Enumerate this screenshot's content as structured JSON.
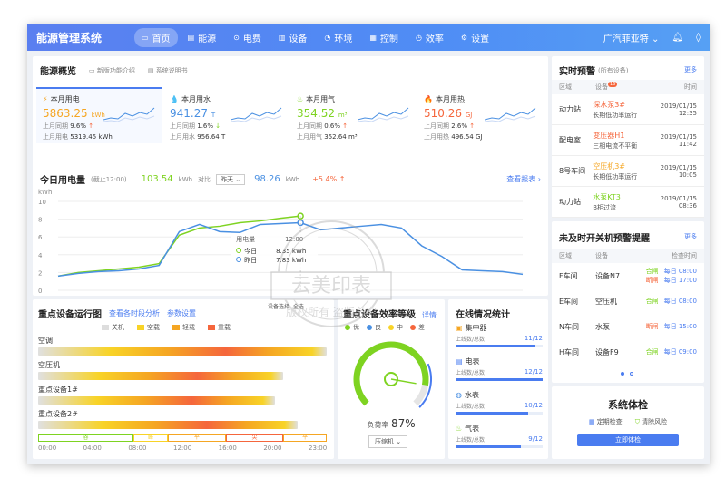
{
  "app": {
    "title": "能源管理系统",
    "user": "广汽菲亚特",
    "user_caret": "⌄"
  },
  "nav": [
    {
      "icon": "▭",
      "label": "首页",
      "active": true
    },
    {
      "icon": "▤",
      "label": "能源"
    },
    {
      "icon": "⊙",
      "label": "电费"
    },
    {
      "icon": "▥",
      "label": "设备"
    },
    {
      "icon": "◔",
      "label": "环境"
    },
    {
      "icon": "▦",
      "label": "控制"
    },
    {
      "icon": "◷",
      "label": "效率"
    },
    {
      "icon": "⚙",
      "label": "设置"
    }
  ],
  "overview": {
    "title": "能源概览",
    "link1": "新版功能介绍",
    "link2": "系统说明书"
  },
  "kpis": [
    {
      "icon": "⚡",
      "color": "#f5a623",
      "title": "本月用电",
      "value": "5863.25",
      "unit": "kWh",
      "ratio_label": "上月同期",
      "ratio": "9.6%",
      "dir": "up",
      "prev_label": "上月用电",
      "prev": "5319.45 kWh"
    },
    {
      "icon": "💧",
      "color": "#4a90e2",
      "title": "本月用水",
      "value": "941.27",
      "unit": "T",
      "ratio_label": "上月同期",
      "ratio": "1.6%",
      "dir": "down",
      "prev_label": "上月用水",
      "prev": "956.64 T"
    },
    {
      "icon": "♨",
      "color": "#7ed321",
      "title": "本月用气",
      "value": "354.52",
      "unit": "m³",
      "ratio_label": "上月同期",
      "ratio": "0.6%",
      "dir": "up",
      "prev_label": "上月用气",
      "prev": "352.64 m³"
    },
    {
      "icon": "🔥",
      "color": "#f5663c",
      "title": "本月用热",
      "value": "510.26",
      "unit": "GJ",
      "ratio_label": "上月同期",
      "ratio": "2.6%",
      "dir": "up",
      "prev_label": "上月用热",
      "prev": "496.54 GJ"
    }
  ],
  "today": {
    "title": "今日用电量",
    "note": "(截止12:00)",
    "value": "103.54",
    "unit": "kWh",
    "compare_label": "对比",
    "select": "昨天",
    "compare_value": "98.26",
    "compare_unit": "kWh",
    "delta": "+5.4%",
    "report": "查看报表"
  },
  "chart_data": {
    "type": "line",
    "ylabel": "kWh",
    "ylim": [
      0,
      10
    ],
    "yticks": [
      0,
      2,
      4,
      6,
      8,
      10
    ],
    "xticks": [
      "00:00",
      "02:00",
      "04:00",
      "06:00",
      "08:00",
      "10:00",
      "12:00",
      "14:00",
      "16:00",
      "18:00",
      "20:00",
      "23:00"
    ],
    "series": [
      {
        "name": "今日",
        "color": "#7ed321",
        "x": [
          0,
          1,
          2,
          3,
          4,
          5,
          6,
          7,
          8,
          9,
          10,
          11,
          12
        ],
        "values": [
          1.6,
          2.0,
          2.2,
          2.4,
          2.6,
          3.0,
          6.2,
          7.0,
          7.2,
          7.6,
          7.8,
          8.1,
          8.35
        ]
      },
      {
        "name": "昨日",
        "color": "#4a90e2",
        "x": [
          0,
          1,
          2,
          3,
          4,
          5,
          6,
          7,
          8,
          9,
          10,
          11,
          12,
          13,
          14,
          15,
          16,
          17,
          18,
          19,
          20,
          21,
          22,
          23
        ],
        "values": [
          1.6,
          1.9,
          2.1,
          2.2,
          2.4,
          2.8,
          6.6,
          7.4,
          6.6,
          6.5,
          7.4,
          7.5,
          7.6,
          6.8,
          7.0,
          7.2,
          7.4,
          7.0,
          5.0,
          3.8,
          2.3,
          2.2,
          2.1,
          1.8
        ]
      }
    ],
    "tooltip": {
      "title": "用电量",
      "time": "12:00",
      "rows": [
        {
          "name": "今日",
          "value": "8.35 kWh"
        },
        {
          "name": "昨日",
          "value": "7.83 kWh"
        }
      ]
    }
  },
  "alarms": {
    "title": "实时预警",
    "subtitle": "(所有设备)",
    "more": "更多",
    "headers": [
      "区域",
      "设备",
      "时间"
    ],
    "badge": "16",
    "rows": [
      {
        "area": "动力站",
        "device": "深水泵3#",
        "color": "#f5663c",
        "desc": "长期低功率运行",
        "date": "2019/01/15",
        "time": "12:35"
      },
      {
        "area": "配电室",
        "device": "变压器H1",
        "color": "#f5663c",
        "desc": "三相电流不平衡",
        "date": "2019/01/15",
        "time": "11:42"
      },
      {
        "area": "8号车间",
        "device": "空压机3#",
        "color": "#f5a623",
        "desc": "长期低功率运行",
        "date": "2019/01/15",
        "time": "10:05"
      },
      {
        "area": "动力站",
        "device": "水泵KT3",
        "color": "#7ed321",
        "desc": "B相过流",
        "date": "2019/01/15",
        "time": "08:36"
      }
    ]
  },
  "shutdown": {
    "title": "未及时开关机预警提醒",
    "more": "更多",
    "headers": [
      "区域",
      "设备",
      "检查时间"
    ],
    "rows": [
      {
        "area": "F车间",
        "device": "设备N7",
        "tags": [
          {
            "t": "合闸",
            "c": "#7ed321",
            "v": "每日 08:00"
          },
          {
            "t": "断闸",
            "c": "#f5663c",
            "v": "每日 17:00"
          }
        ]
      },
      {
        "area": "E车间",
        "device": "空压机",
        "tags": [
          {
            "t": "合闸",
            "c": "#7ed321",
            "v": "每日 08:00"
          }
        ]
      },
      {
        "area": "N车间",
        "device": "水泵",
        "tags": [
          {
            "t": "断闸",
            "c": "#f5663c",
            "v": "每日 15:00"
          }
        ]
      },
      {
        "area": "H车间",
        "device": "设备F9",
        "tags": [
          {
            "t": "合闸",
            "c": "#7ed321",
            "v": "每日 09:00"
          }
        ]
      }
    ]
  },
  "health": {
    "title": "系统体检",
    "opt1": "定期检查",
    "opt2": "清除风险",
    "button": "立即体检"
  },
  "running": {
    "title": "重点设备运行图",
    "link1": "查看各时段分析",
    "link2": "参数设置",
    "legend": [
      {
        "name": "关机",
        "color": "#dddddd"
      },
      {
        "name": "空载",
        "color": "#f8d327"
      },
      {
        "name": "轻载",
        "color": "#f5a623"
      },
      {
        "name": "重载",
        "color": "#f5663c"
      }
    ],
    "rows": [
      {
        "name": "空调",
        "value": 1.0
      },
      {
        "name": "空压机",
        "value": 0.85
      },
      {
        "name": "重点设备1#",
        "value": 0.82
      },
      {
        "name": "重点设备2#",
        "value": 0.9
      }
    ],
    "periods": [
      "谷",
      "峰",
      "平",
      "尖",
      "平"
    ],
    "xticks": [
      "00:00",
      "04:00",
      "08:00",
      "12:00",
      "16:00",
      "20:00",
      "23:00"
    ]
  },
  "efficiency": {
    "title": "重点设备效率等级",
    "select_label": "设备选择",
    "select_value": "全选",
    "more": "详情",
    "legend": [
      {
        "name": "优",
        "color": "#7ed321"
      },
      {
        "name": "良",
        "color": "#4a90e2"
      },
      {
        "name": "中",
        "color": "#f8d327"
      },
      {
        "name": "差",
        "color": "#f5663c"
      }
    ],
    "rate_label": "负荷率",
    "rate": "87%",
    "rate_value": 0.87,
    "device": "压缩机"
  },
  "online": {
    "title": "在线情况统计",
    "sub": "上线数/总数",
    "items": [
      {
        "name": "集中器",
        "icon": "▣",
        "color": "#f5a623",
        "val": "11/12",
        "ratio": 0.92
      },
      {
        "name": "电表",
        "icon": "▤",
        "color": "#4a7cf0",
        "val": "12/12",
        "ratio": 1
      },
      {
        "name": "水表",
        "icon": "◍",
        "color": "#4a90e2",
        "val": "10/12",
        "ratio": 0.83
      },
      {
        "name": "气表",
        "icon": "♨",
        "color": "#7ed321",
        "val": "9/12",
        "ratio": 0.75
      }
    ]
  }
}
